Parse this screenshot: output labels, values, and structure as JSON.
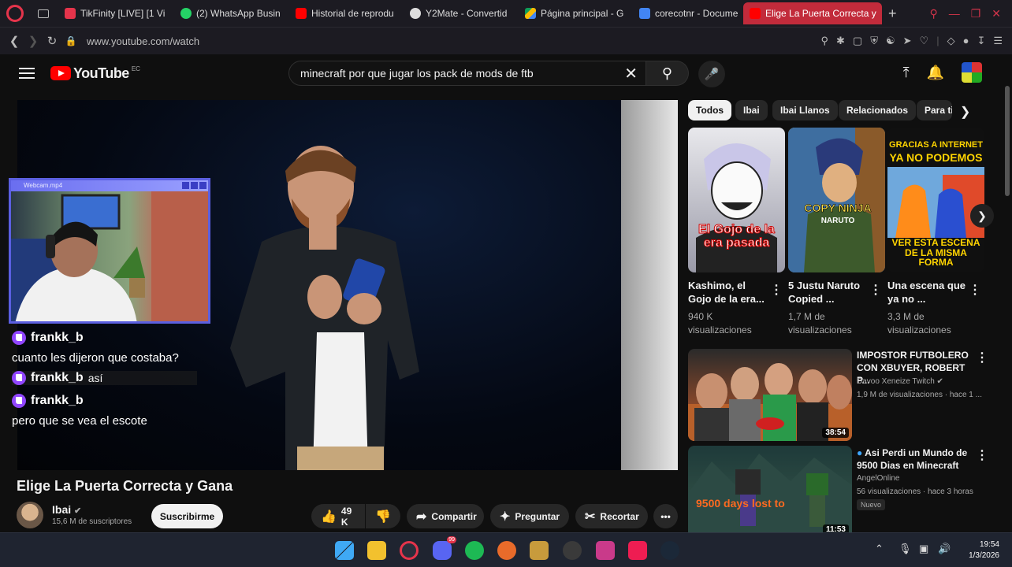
{
  "browser": {
    "tabs": [
      {
        "label": "TikFinity [LIVE] [1 Vi",
        "color": "#e5344b"
      },
      {
        "label": "(2) WhatsApp Busin",
        "color": "#25d366"
      },
      {
        "label": "Historial de reprodu",
        "color": "#ff0000"
      },
      {
        "label": "Y2Mate - Convertid",
        "color": "#dddddd"
      },
      {
        "label": "Página principal - G",
        "color": "#fbbc04"
      },
      {
        "label": "corecotnr - Docume",
        "color": "#4285f4"
      },
      {
        "label": "Elige La Puerta Correcta y",
        "color": "#ff0000",
        "active": true
      }
    ],
    "new_tab": "+",
    "url": "www.youtube.com/watch"
  },
  "header": {
    "logo_text": "YouTube",
    "country_code": "EC",
    "search_value": "minecraft por que jugar los pack de mods de ftb"
  },
  "video": {
    "title": "Elige La Puerta Correcta y Gana",
    "channel": "Ibai",
    "subscribers": "15,6 M de suscriptores",
    "subscribe_label": "Suscribirme",
    "likes": "49 K",
    "share_label": "Compartir",
    "ask_label": "Preguntar",
    "clip_label": "Recortar"
  },
  "overlay": {
    "webcam_title": "Webcam.mp4",
    "chat": [
      {
        "user": "frankk_b",
        "message": "cuanto les dijeron que costaba?"
      },
      {
        "user": "frankk_b",
        "message": "así"
      },
      {
        "user": "frankk_b",
        "message": "pero que se vea el escote"
      }
    ]
  },
  "chips": [
    "Todos",
    "Ibai",
    "Ibai Llanos",
    "Relacionados",
    "Para ti"
  ],
  "shorts": [
    {
      "title": "Kashimo, el Gojo de la era...",
      "views": "940 K visualizaciones",
      "thumb_text": "El Gojo de la era pasada"
    },
    {
      "title": "5 Justu Naruto Copied ...",
      "views": "1,7 M de visualizaciones",
      "thumb_text": "COPY NINJA",
      "thumb_sub": "NARUTO"
    },
    {
      "title": "Una escena que ya no ...",
      "views": "3,3 M de visualizaciones",
      "thumb_top": "GRACIAS A INTERNET",
      "thumb_top2": "YA NO PODEMOS",
      "thumb_bottom": "VER ESTA ESCENA DE LA MISMA FORMA"
    }
  ],
  "recommended": [
    {
      "title": "IMPOSTOR FUTBOLERO CON XBUYER, ROBERT P...",
      "channel": "Davoo Xeneize Twitch",
      "meta": "1,9 M de visualizaciones · hace 1 ...",
      "duration": "38:54"
    },
    {
      "title": "Asi Perdi un Mundo de 9500 Dias en Minecraft",
      "channel": "AngelOnline",
      "meta": "56 visualizaciones · hace 3 horas",
      "duration": "11:53",
      "badge": "Nuevo",
      "thumb_text": "9500 days lost to"
    }
  ],
  "taskbar": {
    "time": "19:54",
    "date": "1/3/2026",
    "discord_badge": "99"
  }
}
